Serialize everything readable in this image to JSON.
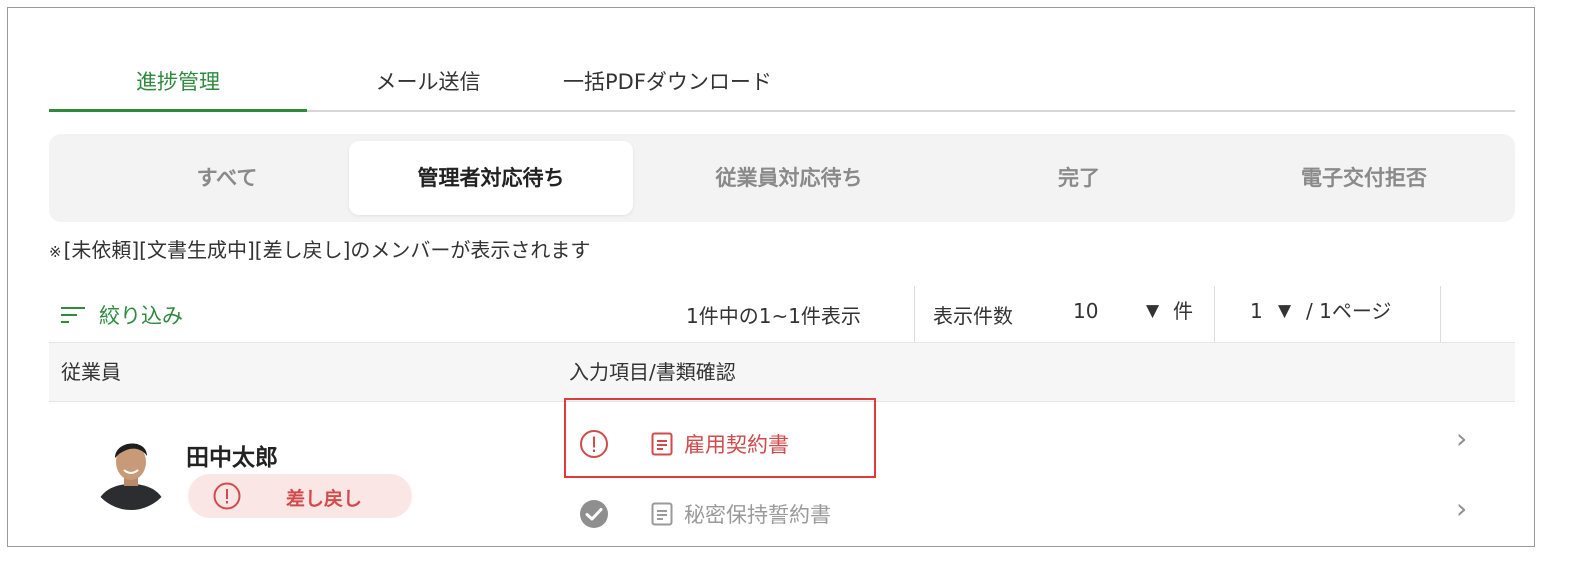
{
  "tabs": [
    {
      "label": "進捗管理",
      "active": true
    },
    {
      "label": "メール送信",
      "active": false
    },
    {
      "label": "一括PDFダウンロード",
      "active": false
    }
  ],
  "status_filter": [
    {
      "label": "すべて",
      "active": false
    },
    {
      "label": "管理者対応待ち",
      "active": true
    },
    {
      "label": "従業員対応待ち",
      "active": false
    },
    {
      "label": "完了",
      "active": false
    },
    {
      "label": "電子交付拒否",
      "active": false
    }
  ],
  "note": {
    "mark": "※",
    "text": "[未依頼][文書生成中][差し戻し]のメンバーが表示されます"
  },
  "toolbar": {
    "filter_label": "絞り込み",
    "result_count": "1件中の1~1件表示",
    "per_page_label": "表示件数",
    "per_page_value": "10",
    "per_page_arrow": "▼",
    "per_page_unit": "件",
    "page_value": "1",
    "page_arrow": "▼",
    "page_total": "/ 1ページ"
  },
  "table": {
    "headers": [
      "従業員",
      "入力項目/書類確認"
    ],
    "rows": [
      {
        "employee_name": "田中太郎",
        "status_badge": "差し戻し",
        "documents": [
          {
            "name": "雇用契約書",
            "state": "error"
          },
          {
            "name": "秘密保持誓約書",
            "state": "done"
          }
        ]
      }
    ]
  },
  "icons": {
    "chevron": "›",
    "filter": "filter-lines-icon",
    "error": "exclamation-circle-icon",
    "done": "check-circle-icon",
    "doc": "document-icon"
  },
  "colors": {
    "accent": "#2e8b3d",
    "error": "#d24a4a",
    "badge_bg": "#fbe6e6",
    "highlight": "#e03a3a",
    "muted": "#9a9a9a"
  }
}
